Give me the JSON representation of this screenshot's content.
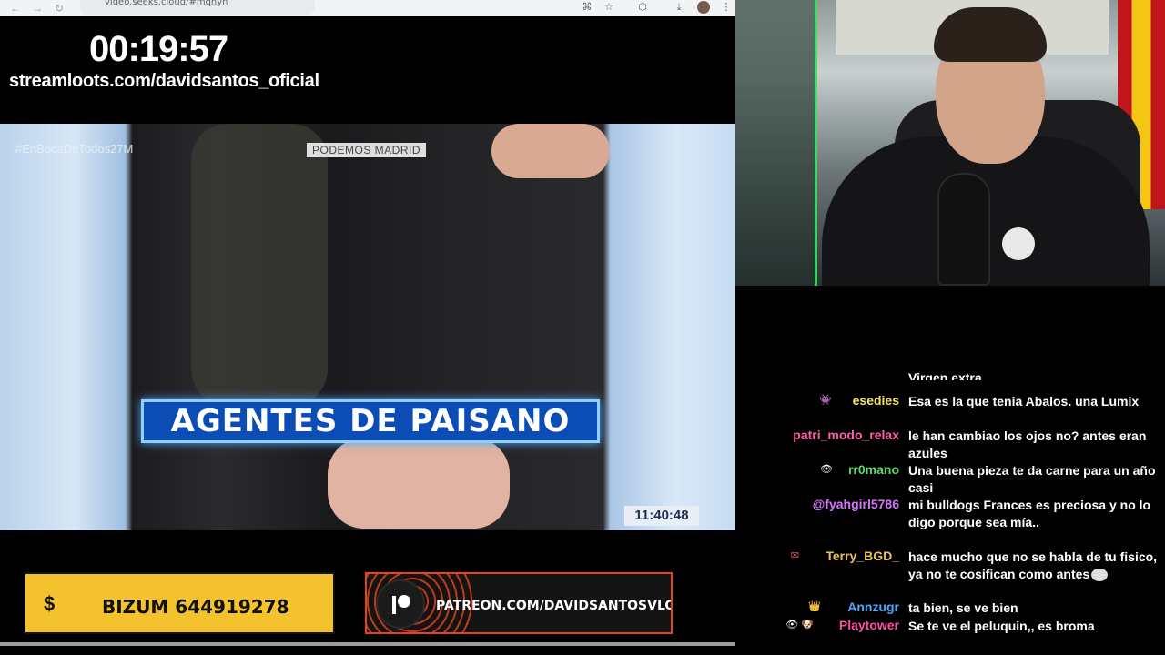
{
  "browser": {
    "url": "video.seeks.cloud/#mqnyh",
    "back_icon": "arrow-left-icon",
    "forward_icon": "arrow-right-icon",
    "reload_icon": "reload-icon"
  },
  "overlay": {
    "timer": "00:19:57",
    "promo_url": "streamloots.com/davidsantos_oficial"
  },
  "clip": {
    "hashtag": "#EnBocaDeTodos27M",
    "channel_tag": "PODEMOS MADRID",
    "headline": "AGENTES DE PAISANO",
    "clock": "11:40:48"
  },
  "banners": {
    "bizum_icon": "$",
    "bizum_label": "BIZUM 644919278",
    "patreon_label": "PATREON.COM/DAVIDSANTOSVLOG"
  },
  "chat": {
    "cut_line": "Virgen extra",
    "messages": [
      {
        "user": "esedies",
        "color": "#f5e663",
        "badges": "👾",
        "text": "Esa es la que tenia Abalos. una Lumix"
      },
      {
        "user": "patri_modo_relax",
        "color": "#ff5fa8",
        "badges": "",
        "text": "le han cambiao los ojos no? antes eran azules"
      },
      {
        "user": "rr0mano",
        "color": "#62d66a",
        "badges": "👁",
        "text": "Una buena pieza te da carne para un año casi"
      },
      {
        "user": "@fyahgirl5786",
        "color": "#d774ff",
        "badges": "",
        "text": "mi bulldogs Frances es preciosa y no lo digo porque sea mía.."
      },
      {
        "user": "Terry_BGD_",
        "color": "#e8c25a",
        "badges": "✉",
        "text": "hace mucho que no se habla de tu fisico, ya no te cosifican como antes"
      },
      {
        "user": "Annzugr",
        "color": "#4ea8ff",
        "badges": "👑",
        "text": "ta bien, se ve bien"
      },
      {
        "user": "Playtower",
        "color": "#ff4fa1",
        "badges": "👁 🐶",
        "text": "Se te ve el peluquin,, es broma"
      }
    ]
  }
}
